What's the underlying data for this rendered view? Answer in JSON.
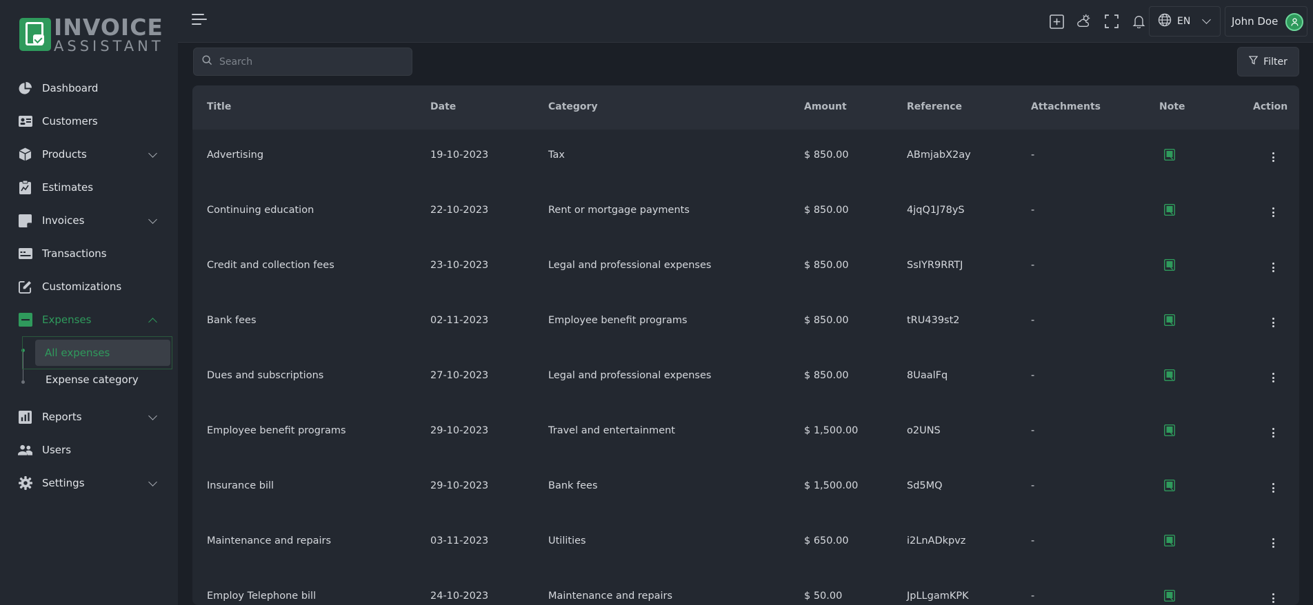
{
  "brand": {
    "line1": "INVOICE",
    "line2": "ASSISTANT",
    "accent": "#2f9a5c"
  },
  "sidebar": {
    "items": [
      {
        "label": "Dashboard",
        "icon": "pie-chart-icon",
        "expandable": false
      },
      {
        "label": "Customers",
        "icon": "id-card-icon",
        "expandable": false
      },
      {
        "label": "Products",
        "icon": "box-icon",
        "expandable": true
      },
      {
        "label": "Estimates",
        "icon": "clipboard-icon",
        "expandable": false
      },
      {
        "label": "Invoices",
        "icon": "invoice-icon",
        "expandable": true
      },
      {
        "label": "Transactions",
        "icon": "money-icon",
        "expandable": false
      },
      {
        "label": "Customizations",
        "icon": "edit-icon",
        "expandable": false
      },
      {
        "label": "Expenses",
        "icon": "minus-square-icon",
        "expandable": true,
        "active": true
      },
      {
        "label": "Reports",
        "icon": "reports-icon",
        "expandable": true
      },
      {
        "label": "Users",
        "icon": "users-icon",
        "expandable": false
      },
      {
        "label": "Settings",
        "icon": "gear-icon",
        "expandable": true
      }
    ],
    "expenses_submenu": [
      {
        "label": "All expenses",
        "active": true
      },
      {
        "label": "Expense category",
        "active": false
      }
    ]
  },
  "header": {
    "language": "EN",
    "user_name": "John Doe",
    "icons": [
      "add-icon",
      "weather-icon",
      "fullscreen-icon",
      "bell-icon",
      "globe-icon"
    ]
  },
  "toolbar": {
    "search_placeholder": "Search",
    "filter_label": "Filter"
  },
  "table": {
    "columns": [
      "Title",
      "Date",
      "Category",
      "Amount",
      "Reference",
      "Attachments",
      "Note",
      "Action"
    ],
    "rows": [
      {
        "title": "Advertising",
        "date": "19-10-2023",
        "category": "Tax",
        "amount": "$ 850.00",
        "reference": "ABmjabX2ay",
        "attachments": "-"
      },
      {
        "title": "Continuing education",
        "date": "22-10-2023",
        "category": "Rent or mortgage payments",
        "amount": "$ 850.00",
        "reference": "4jqQ1J78yS",
        "attachments": "-"
      },
      {
        "title": "Credit and collection fees",
        "date": "23-10-2023",
        "category": "Legal and professional expenses",
        "amount": "$ 850.00",
        "reference": "SsIYR9RRTJ",
        "attachments": "-"
      },
      {
        "title": "Bank fees",
        "date": "02-11-2023",
        "category": "Employee benefit programs",
        "amount": "$ 850.00",
        "reference": "tRU439st2",
        "attachments": "-"
      },
      {
        "title": "Dues and subscriptions",
        "date": "27-10-2023",
        "category": "Legal and professional expenses",
        "amount": "$ 850.00",
        "reference": "8UaalFq",
        "attachments": "-"
      },
      {
        "title": "Employee benefit programs",
        "date": "29-10-2023",
        "category": "Travel and entertainment",
        "amount": "$ 1,500.00",
        "reference": "o2UNS",
        "attachments": "-"
      },
      {
        "title": "Insurance bill",
        "date": "29-10-2023",
        "category": "Bank fees",
        "amount": "$ 1,500.00",
        "reference": "Sd5MQ",
        "attachments": "-"
      },
      {
        "title": "Maintenance and repairs",
        "date": "03-11-2023",
        "category": "Utilities",
        "amount": "$ 650.00",
        "reference": "i2LnADkpvz",
        "attachments": "-"
      },
      {
        "title": "Employ Telephone bill",
        "date": "24-10-2023",
        "category": "Maintenance and repairs",
        "amount": "$ 50.00",
        "reference": "JpLLgamKPK",
        "attachments": "-"
      }
    ]
  }
}
